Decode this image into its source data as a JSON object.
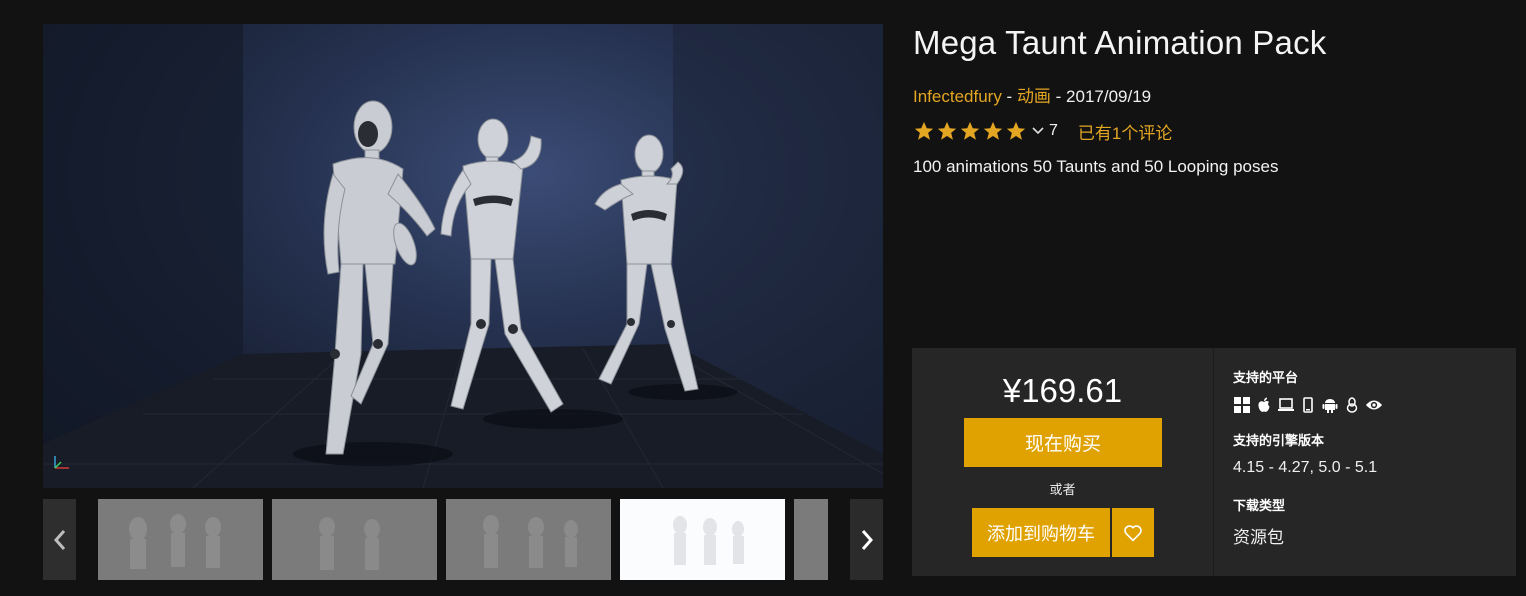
{
  "product": {
    "title": "Mega Taunt Animation Pack",
    "author": "Infectedfury",
    "category": "动画",
    "separator": " - ",
    "date": "2017/09/19",
    "rating_stars": 5,
    "rating_count": "7",
    "reviews_link": "已有1个评论",
    "description": "100 animations 50 Taunts and 50 Looping poses"
  },
  "purchase": {
    "price": "¥169.61",
    "buy_label": "现在购买",
    "or_label": "或者",
    "cart_label": "添加到购物车"
  },
  "details": {
    "platforms_label": "支持的平台",
    "platforms": [
      "windows-icon",
      "apple-icon",
      "laptop-icon",
      "mobile-icon",
      "android-icon",
      "linux-icon",
      "eye-icon"
    ],
    "engine_label": "支持的引擎版本",
    "engine_versions": "4.15 - 4.27, 5.0 - 5.1",
    "download_label": "下载类型",
    "download_type": "资源包"
  },
  "gallery": {
    "thumbnails": [
      "thumbnail-1",
      "thumbnail-2",
      "thumbnail-3",
      "thumbnail-4",
      "thumbnail-5"
    ],
    "active_thumbnail": 4
  },
  "colors": {
    "accent": "#e0a200",
    "link": "#e3a623",
    "background": "#121212",
    "panel": "#262626"
  }
}
